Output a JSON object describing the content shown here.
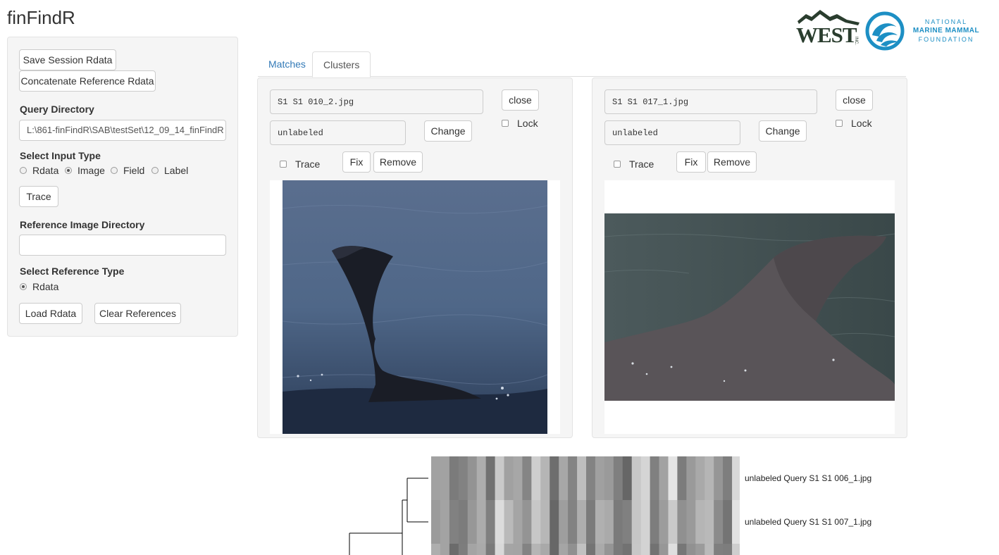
{
  "app": {
    "title": "finFindR"
  },
  "logos": {
    "west": {
      "text": "WEST",
      "sub": "INC.",
      "color": "#2a3d2e"
    },
    "nmmf": {
      "line1": "NATIONAL",
      "line2": "MARINE MAMMAL",
      "line3": "FOUNDATION",
      "color": "#1d8fc4"
    }
  },
  "sidebar": {
    "save_session": "Save Session Rdata",
    "concat_reference": "Concatenate Reference Rdata",
    "query_dir_label": "Query Directory",
    "query_dir_value": "L:\\861-finFindR\\SAB\\testSet\\12_09_14_finFindR",
    "input_type_label": "Select Input Type",
    "input_types": [
      {
        "label": "Rdata",
        "selected": false
      },
      {
        "label": "Image",
        "selected": true
      },
      {
        "label": "Field",
        "selected": false
      },
      {
        "label": "Label",
        "selected": false
      }
    ],
    "trace_button": "Trace",
    "ref_dir_label": "Reference Image Directory",
    "ref_dir_value": "",
    "ref_type_label": "Select Reference Type",
    "ref_types": [
      {
        "label": "Rdata",
        "selected": true
      }
    ],
    "load_rdata": "Load Rdata",
    "clear_references": "Clear References"
  },
  "tabs": [
    {
      "label": "Matches",
      "active": false
    },
    {
      "label": "Clusters",
      "active": true
    }
  ],
  "panels": [
    {
      "filename": "S1 S1 010_2.jpg",
      "label_value": "unlabeled",
      "close": "close",
      "lock": "Lock",
      "change": "Change",
      "trace": "Trace",
      "fix": "Fix",
      "remove": "Remove",
      "image": "dorsal-fin-photo"
    },
    {
      "filename": "S1 S1 017_1.jpg",
      "label_value": "unlabeled",
      "close": "close",
      "lock": "Lock",
      "change": "Change",
      "trace": "Trace",
      "fix": "Fix",
      "remove": "Remove",
      "image": "dorsal-fin-photo"
    }
  ],
  "heatmap": {
    "rows": [
      {
        "label": "unlabeled Query S1 S1 006_1.jpg"
      },
      {
        "label": "unlabeled Query S1 S1 007_1.jpg"
      }
    ]
  }
}
